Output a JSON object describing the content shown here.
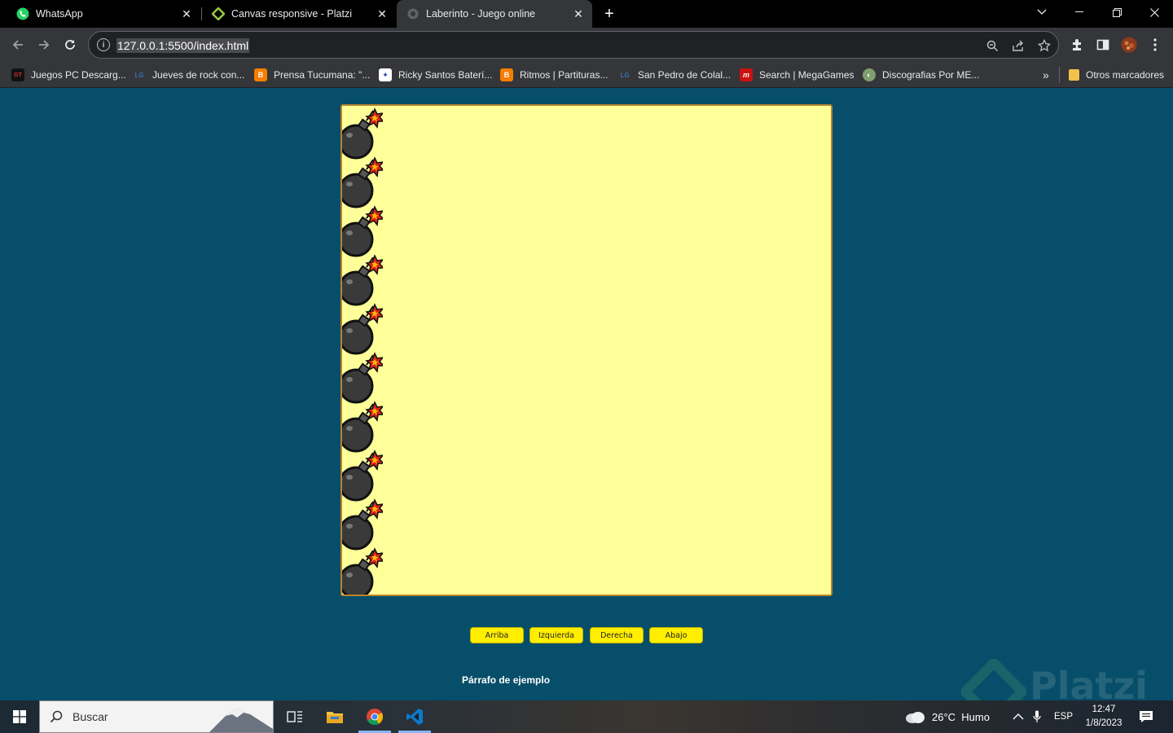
{
  "browser": {
    "tabs": [
      {
        "title": "WhatsApp",
        "icon": "whatsapp-icon",
        "active": false
      },
      {
        "title": "Canvas responsive - Platzi",
        "icon": "platzi-icon",
        "active": false
      },
      {
        "title": "Laberinto - Juego online",
        "icon": "globe-icon",
        "active": true
      }
    ],
    "url": "127.0.0.1:5500/index.html"
  },
  "bookmarks": {
    "items": [
      {
        "label": "Juegos PC Descarg...",
        "icon": "gt-icon",
        "color": "#cc2222"
      },
      {
        "label": "Jueves de rock con...",
        "icon": "lg-icon",
        "color": "#3a6fb0"
      },
      {
        "label": "Prensa Tucumana: \"...",
        "icon": "blogger-icon",
        "color": "#f57d00"
      },
      {
        "label": "Ricky Santos Baterí...",
        "icon": "ricky-icon",
        "color": "#2244aa"
      },
      {
        "label": "Ritmos | Partituras...",
        "icon": "blogger-icon",
        "color": "#f57d00"
      },
      {
        "label": "San Pedro de Colal...",
        "icon": "lg-icon",
        "color": "#3a6fb0"
      },
      {
        "label": "Search | MegaGames",
        "icon": "megagames-icon",
        "color": "#cc1111"
      },
      {
        "label": "Discografias Por ME...",
        "icon": "disc-icon",
        "color": "#7fa06f"
      }
    ],
    "other": "Otros marcadores"
  },
  "game": {
    "bomb_count": 10,
    "buttons": [
      "Arriba",
      "Izquierda",
      "Derecha",
      "Abajo"
    ],
    "paragraph": "Párrafo de ejemplo"
  },
  "taskbar": {
    "search_placeholder": "Buscar",
    "weather": "26°C  Humo",
    "language": "ESP",
    "time": "12:47",
    "date": "1/8/2023",
    "watermark": "Platzi"
  },
  "colors": {
    "page_bg": "#064e69",
    "canvas_bg": "#ffff99",
    "button_bg": "#ffee00"
  }
}
